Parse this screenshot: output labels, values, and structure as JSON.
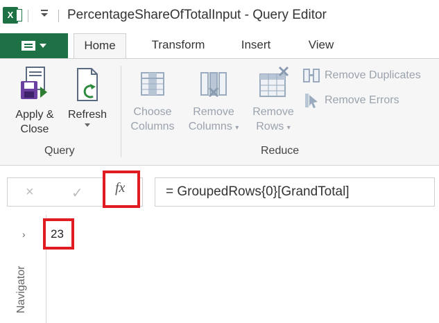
{
  "window": {
    "title": "PercentageShareOfTotalInput - Query Editor",
    "app_icon": "excel-icon",
    "qat_icon": "customize-quick-access-icon"
  },
  "ribbon": {
    "file_tab_icon": "file-menu-icon",
    "tabs": [
      {
        "label": "Home",
        "active": true
      },
      {
        "label": "Transform",
        "active": false
      },
      {
        "label": "Insert",
        "active": false
      },
      {
        "label": "View",
        "active": false
      }
    ],
    "groups": {
      "query": {
        "label": "Query",
        "apply_close": {
          "line1": "Apply &",
          "line2": "Close",
          "icon": "save-close-icon"
        },
        "refresh": {
          "line1": "Refresh",
          "icon": "refresh-icon"
        }
      },
      "reduce": {
        "label": "Reduce",
        "choose_columns": {
          "line1": "Choose",
          "line2": "Columns",
          "icon": "choose-columns-icon"
        },
        "remove_columns": {
          "line1": "Remove",
          "line2": "Columns",
          "icon": "remove-columns-icon"
        },
        "remove_rows": {
          "line1": "Remove",
          "line2": "Rows",
          "icon": "remove-rows-icon"
        },
        "remove_duplicates": {
          "label": "Remove Duplicates",
          "icon": "remove-duplicates-icon"
        },
        "remove_errors": {
          "label": "Remove Errors",
          "icon": "remove-errors-icon"
        }
      }
    },
    "colors": {
      "brand_green": "#1e7145",
      "disabled_text": "#9aa2ad",
      "highlight_red": "#e01b22"
    }
  },
  "formula_bar": {
    "cancel_icon": "cancel-icon",
    "cancel_glyph": "×",
    "confirm_icon": "checkmark-icon",
    "confirm_glyph": "✓",
    "fx_label": "fx",
    "formula": "= GroupedRows{0}[GrandTotal]"
  },
  "navigator": {
    "label": "Navigator",
    "chevron": "›"
  },
  "result": {
    "value": "23"
  }
}
